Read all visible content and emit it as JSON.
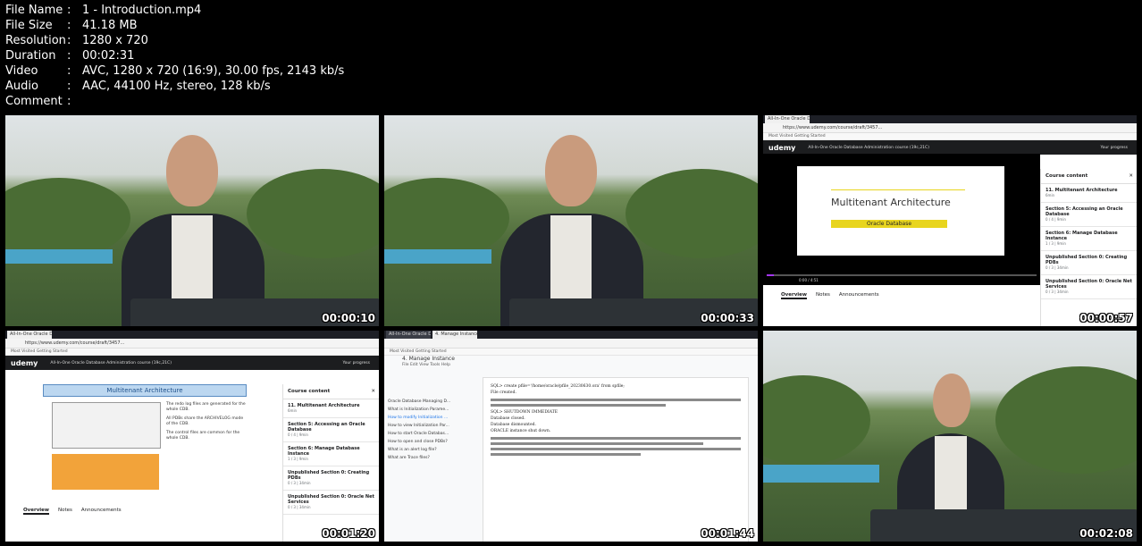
{
  "file_info": [
    {
      "key": "File Name",
      "value": "1 - Introduction.mp4"
    },
    {
      "key": "File Size",
      "value": "41.18 MB"
    },
    {
      "key": "Resolution",
      "value": "1280 x 720"
    },
    {
      "key": "Duration",
      "value": "00:02:31"
    },
    {
      "key": "Video",
      "value": "AVC, 1280 x 720 (16:9), 30.00 fps, 2143 kb/s"
    },
    {
      "key": "Audio",
      "value": "AAC, 44100 Hz, stereo, 128 kb/s"
    },
    {
      "key": "Comment",
      "value": ""
    }
  ],
  "separator": ":",
  "thumbnails": [
    {
      "timestamp": "00:00:10"
    },
    {
      "timestamp": "00:00:33"
    },
    {
      "timestamp": "00:00:57"
    },
    {
      "timestamp": "00:01:20"
    },
    {
      "timestamp": "00:01:44"
    },
    {
      "timestamp": "00:02:08"
    }
  ],
  "udemy": {
    "logo": "udemy",
    "course_title": "All-In-One Oracle Database Administration course (19c,21C)",
    "progress_label": "Your progress",
    "tab_label": "All-In-One Oracle Databas...",
    "url": "https://www.udemy.com/course/draft/3457...",
    "bookmarks": "Most Visited   Getting Started",
    "slide_title": "Multitenant Architecture",
    "slide_subtitle": "Oracle Database",
    "time_readout": "0:00 / 4:51",
    "sidebar_title": "Course content",
    "sidebar_items": [
      {
        "title": "11. Multitenant Architecture",
        "meta": "6min"
      },
      {
        "title": "Section 5: Accessing an Oracle Database",
        "meta": "0 / 4 | 9min"
      },
      {
        "title": "Section 6: Manage Database Instance",
        "meta": "1 / 3 | 9min"
      },
      {
        "title": "Unpublished Section 0: Creating PDBs",
        "meta": "0 / 3 | 34min"
      },
      {
        "title": "Unpublished Section 0: Oracle Net Services",
        "meta": "0 / 3 | 34min"
      }
    ],
    "bottom_tabs": [
      "Overview",
      "Notes",
      "Announcements"
    ],
    "notes": [
      "The redo log files are generated for the whole CDB.",
      "All PDBs share the ARCHIVELOG mode of the CDB.",
      "The control files are common for the whole CDB."
    ]
  },
  "gdoc": {
    "tab_label": "4. Manage Instance - Google...",
    "title": "4. Manage Instance",
    "menu": "File  Edit  View  Tools  Help",
    "outline": [
      "Oracle Database Managing D...",
      "What is Initialization Parame...",
      "How to modify Initialization ...",
      "How to view Initialization Par...",
      "How to start Oracle Databas...",
      "How to open and close PDBs?",
      "What is an alert log file?",
      "What are Trace files?"
    ],
    "doc_lines": [
      "SQL> create pfile='/home/oracle/pfile_20230630.ora' from spfile;",
      "File created.",
      "SQL> SHUTDOWN IMMEDIATE",
      "Database closed.",
      "Database dismounted.",
      "ORACLE instance shut down."
    ]
  }
}
